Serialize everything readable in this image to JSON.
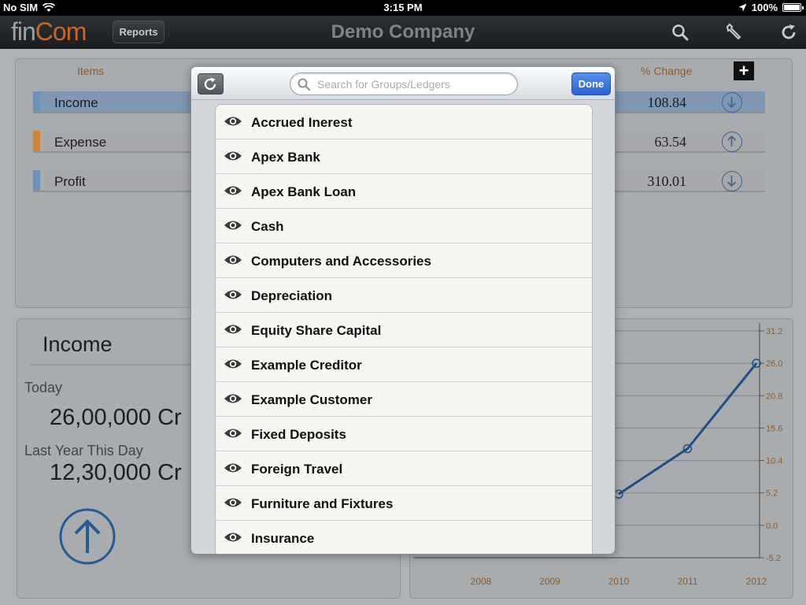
{
  "status_bar": {
    "carrier": "No SIM",
    "time": "3:15 PM",
    "battery": "100%",
    "battery_level": 1.0
  },
  "nav": {
    "logo_fin": "fin",
    "logo_com": "Com",
    "reports_label": "Reports",
    "title": "Demo Company"
  },
  "items_panel": {
    "headers": {
      "items": "Items",
      "change": "% Change"
    },
    "rows": [
      {
        "label": "Income",
        "pct": "108.84",
        "color": "#6f90b8",
        "direction": "down"
      },
      {
        "label": "Expense",
        "pct": "63.54",
        "color": "#c9863a",
        "direction": "up"
      },
      {
        "label": "Profit",
        "pct": "310.01",
        "color": "#6f90b8",
        "direction": "down"
      }
    ]
  },
  "income_panel": {
    "title": "Income",
    "today_label": "Today",
    "today_value": "26,00,000 Cr",
    "last_year_label": "Last Year This Day",
    "last_year_value": "12,30,000 Cr"
  },
  "chart_data": {
    "type": "line",
    "x": [
      "2008",
      "2009",
      "2010",
      "2011",
      "2012"
    ],
    "series": [
      {
        "values": [
          null,
          null,
          5.0,
          12.3,
          26.0
        ]
      }
    ],
    "y_ticks": [
      "31.2",
      "26.0",
      "20.8",
      "15.6",
      "10.4",
      "5.2",
      "0.0",
      "-5.2"
    ],
    "ylim": [
      -5.2,
      31.2
    ],
    "grid": true,
    "line_color": "#1e4f84"
  },
  "modal": {
    "search_placeholder": "Search for Groups/Ledgers",
    "done_label": "Done",
    "items": [
      "Accrued Inerest",
      "Apex Bank",
      "Apex Bank Loan",
      "Cash",
      "Computers and Accessories",
      "Depreciation",
      "Equity Share Capital",
      "Example Creditor",
      "Example Customer",
      "Fixed Deposits",
      "Foreign Travel",
      "Furniture and Fixtures",
      "Insurance"
    ]
  }
}
